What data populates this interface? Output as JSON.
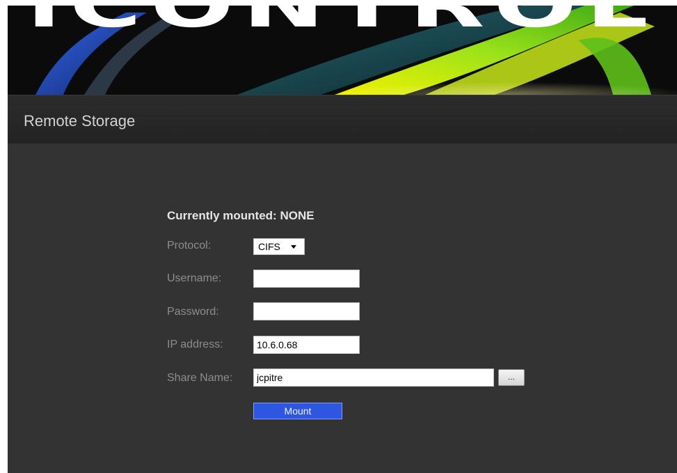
{
  "banner": {
    "brand": "iCONTROL"
  },
  "header": {
    "title": "Remote Storage"
  },
  "form": {
    "mount_status": "Currently mounted: NONE",
    "protocol": {
      "label": "Protocol:",
      "selected": "CIFS"
    },
    "username": {
      "label": "Username:",
      "value": ""
    },
    "password": {
      "label": "Password:",
      "value": ""
    },
    "ip_address": {
      "label": "IP address:",
      "value": "10.6.0.68"
    },
    "share_name": {
      "label": "Share Name:",
      "value": "jcpitre",
      "browse_label": "..."
    },
    "mount_label": "Mount"
  },
  "colors": {
    "accent_button": "#2f56e0",
    "background": "#333333"
  },
  "icons": {
    "dropdown": "chevron-down-icon"
  }
}
